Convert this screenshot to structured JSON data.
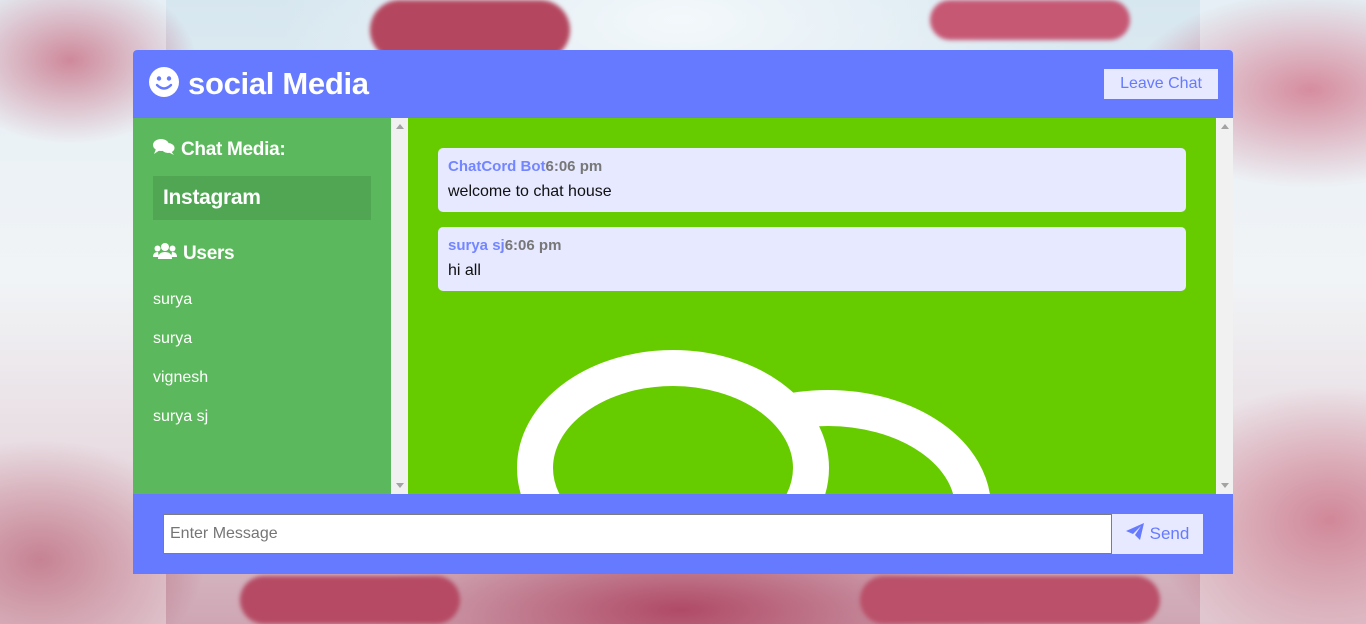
{
  "header": {
    "title": "social Media",
    "leave_label": "Leave Chat",
    "logo_icon": "smile-icon"
  },
  "sidebar": {
    "room_heading": "Chat Media:",
    "room_icon": "comments-icon",
    "room_name": "Instagram",
    "users_heading": "Users",
    "users_icon": "users-icon",
    "users": [
      "surya",
      "surya",
      "vignesh",
      "surya sj"
    ]
  },
  "messages": [
    {
      "user": "ChatCord Bot",
      "time": "6:06 pm",
      "text": "welcome to chat house"
    },
    {
      "user": "surya sj",
      "time": "6:06 pm",
      "text": "hi all"
    }
  ],
  "form": {
    "placeholder": "Enter Message",
    "value": "",
    "send_label": "Send",
    "send_icon": "paper-plane-icon"
  },
  "colors": {
    "header": "#667aff",
    "sidebar": "#5cb85c",
    "room_highlight": "#50a653",
    "messages_bg": "#66cc00",
    "message_bubble": "#e6e9ff",
    "username": "#7386ff"
  }
}
